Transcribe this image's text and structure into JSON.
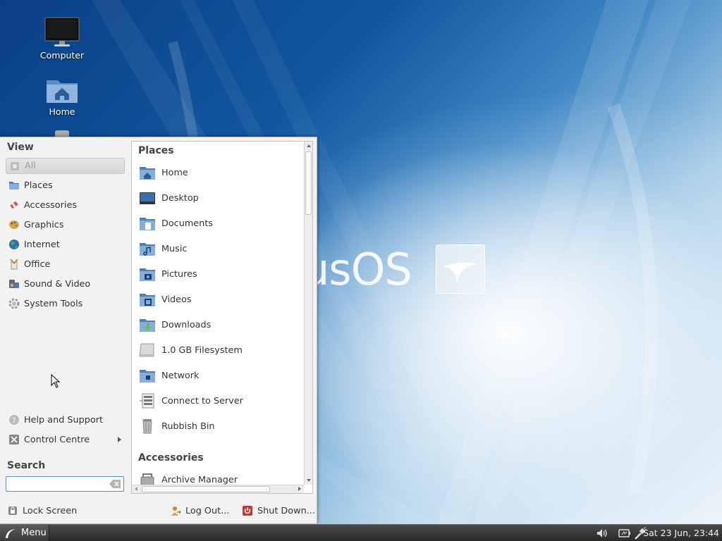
{
  "desktop": {
    "icons": [
      {
        "label": "Computer",
        "icon": "monitor-icon"
      },
      {
        "label": "Home",
        "icon": "home-folder-icon"
      },
      {
        "label": "",
        "icon": "rubbish-bin-icon"
      }
    ],
    "watermark_text": "usOS"
  },
  "menu": {
    "view_title": "View",
    "categories": [
      {
        "label": "All",
        "icon": "all-icon",
        "selected": true
      },
      {
        "label": "Places",
        "icon": "folder-icon"
      },
      {
        "label": "Accessories",
        "icon": "accessories-icon"
      },
      {
        "label": "Graphics",
        "icon": "graphics-icon"
      },
      {
        "label": "Internet",
        "icon": "globe-icon"
      },
      {
        "label": "Office",
        "icon": "office-icon"
      },
      {
        "label": "Sound & Video",
        "icon": "multimedia-icon"
      },
      {
        "label": "System Tools",
        "icon": "gear-icon"
      }
    ],
    "help_label": "Help and Support",
    "control_centre_label": "Control Centre",
    "search_title": "Search",
    "search_value": "",
    "search_placeholder": "",
    "lock_label": "Lock Screen",
    "logout_label": "Log Out...",
    "shutdown_label": "Shut Down...",
    "apps_pane": {
      "sections": [
        {
          "title": "Places",
          "items": [
            {
              "label": "Home",
              "icon": "home-folder-icon"
            },
            {
              "label": "Desktop",
              "icon": "desktop-icon"
            },
            {
              "label": "Documents",
              "icon": "documents-folder-icon"
            },
            {
              "label": "Music",
              "icon": "music-folder-icon"
            },
            {
              "label": "Pictures",
              "icon": "pictures-folder-icon"
            },
            {
              "label": "Videos",
              "icon": "videos-folder-icon"
            },
            {
              "label": "Downloads",
              "icon": "downloads-folder-icon"
            },
            {
              "label": "1.0 GB Filesystem",
              "icon": "drive-icon"
            },
            {
              "label": "Network",
              "icon": "network-folder-icon"
            },
            {
              "label": "Connect to Server",
              "icon": "server-icon"
            },
            {
              "label": "Rubbish Bin",
              "icon": "rubbish-bin-icon"
            }
          ]
        },
        {
          "title": "Accessories",
          "items": [
            {
              "label": "Archive Manager",
              "icon": "archive-icon"
            }
          ]
        }
      ]
    }
  },
  "panel": {
    "menu_label": "Menu",
    "clock": "Sat 23 Jun, 23:44",
    "tray_icons": [
      "volume-icon",
      "battery-icon",
      "network-cable-icon"
    ]
  }
}
